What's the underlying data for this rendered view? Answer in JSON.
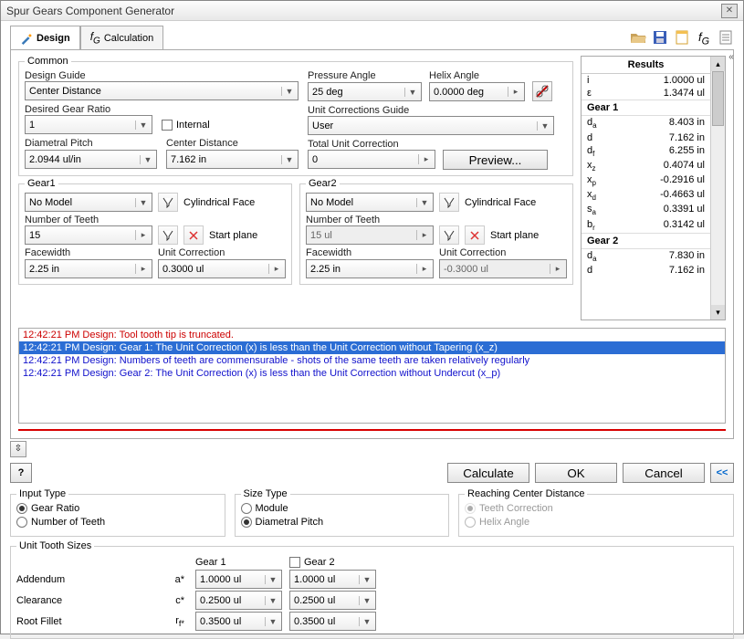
{
  "window": {
    "title": "Spur Gears Component Generator"
  },
  "tabs": {
    "design": "Design",
    "calculation": "Calculation"
  },
  "common": {
    "legend": "Common",
    "designGuideLabel": "Design Guide",
    "designGuideValue": "Center Distance",
    "desiredRatioLabel": "Desired Gear Ratio",
    "desiredRatioValue": "1",
    "internalLabel": "Internal",
    "diametralPitchLabel": "Diametral Pitch",
    "diametralPitchValue": "2.0944 ul/in",
    "centerDistanceLabel": "Center Distance",
    "centerDistanceValue": "7.162 in",
    "pressureAngleLabel": "Pressure Angle",
    "pressureAngleValue": "25 deg",
    "helixAngleLabel": "Helix Angle",
    "helixAngleValue": "0.0000 deg",
    "unitCorrGuideLabel": "Unit Corrections Guide",
    "unitCorrGuideValue": "User",
    "totalUnitCorrLabel": "Total Unit Correction",
    "totalUnitCorrValue": "0",
    "previewLabel": "Preview..."
  },
  "gear1": {
    "legend": "Gear1",
    "modelValue": "No Model",
    "cylFace": "Cylindrical Face",
    "numTeethLabel": "Number of Teeth",
    "numTeethValue": "15",
    "startPlane": "Start plane",
    "facewidthLabel": "Facewidth",
    "facewidthValue": "2.25 in",
    "unitCorrLabel": "Unit Correction",
    "unitCorrValue": "0.3000 ul"
  },
  "gear2": {
    "legend": "Gear2",
    "modelValue": "No Model",
    "cylFace": "Cylindrical Face",
    "numTeethLabel": "Number of Teeth",
    "numTeethValue": "15 ul",
    "startPlane": "Start plane",
    "facewidthLabel": "Facewidth",
    "facewidthValue": "2.25 in",
    "unitCorrLabel": "Unit Correction",
    "unitCorrValue": "-0.3000 ul"
  },
  "results": {
    "title": "Results",
    "rows1": [
      {
        "k": "i",
        "v": "1.0000 ul"
      },
      {
        "k": "ε",
        "v": "1.3474 ul"
      }
    ],
    "g1title": "Gear 1",
    "g1rows": [
      {
        "k": "d<sub>a</sub>",
        "v": "8.403 in"
      },
      {
        "k": "d",
        "v": "7.162 in"
      },
      {
        "k": "d<sub>f</sub>",
        "v": "6.255 in"
      },
      {
        "k": "x<sub>z</sub>",
        "v": "0.4074 ul"
      },
      {
        "k": "x<sub>p</sub>",
        "v": "-0.2916 ul"
      },
      {
        "k": "x<sub>d</sub>",
        "v": "-0.4663 ul"
      },
      {
        "k": "s<sub>a</sub>",
        "v": "0.3391 ul"
      },
      {
        "k": "b<sub>r</sub>",
        "v": "0.3142 ul"
      }
    ],
    "g2title": "Gear 2",
    "g2rows": [
      {
        "k": "d<sub>a</sub>",
        "v": "7.830 in"
      },
      {
        "k": "d",
        "v": "7.162 in"
      }
    ]
  },
  "log": [
    {
      "t": "12:42:21 PM Design: Tool tooth tip is truncated.",
      "cls": "log-red"
    },
    {
      "t": "12:42:21 PM Design: Gear 1: The Unit Correction (x) is less than the Unit Correction without Tapering (x_z)",
      "cls": "log-sel"
    },
    {
      "t": "12:42:21 PM Design: Numbers of teeth are commensurable - shots of the same teeth are taken relatively regularly",
      "cls": "log-blue"
    },
    {
      "t": "12:42:21 PM Design: Gear 2: The Unit Correction (x) is less than the Unit Correction without Undercut (x_p)",
      "cls": "log-blue"
    }
  ],
  "buttons": {
    "calculate": "Calculate",
    "ok": "OK",
    "cancel": "Cancel"
  },
  "inputType": {
    "legend": "Input Type",
    "gearRatio": "Gear Ratio",
    "numTeeth": "Number of Teeth"
  },
  "sizeType": {
    "legend": "Size Type",
    "module": "Module",
    "diametralPitch": "Diametral Pitch"
  },
  "reachCenter": {
    "legend": "Reaching Center Distance",
    "teethCorr": "Teeth Correction",
    "helixAngle": "Helix Angle"
  },
  "tooth": {
    "legend": "Unit Tooth Sizes",
    "g1": "Gear 1",
    "g2": "Gear 2",
    "addendum": "Addendum",
    "addSym": "a*",
    "addV1": "1.0000 ul",
    "addV2": "1.0000 ul",
    "clearance": "Clearance",
    "clrSym": "c*",
    "clrV1": "0.2500 ul",
    "clrV2": "0.2500 ul",
    "rootFillet": "Root Fillet",
    "rfSym": "r",
    "rfSub": "f*",
    "rfV1": "0.3500 ul",
    "rfV2": "0.3500 ul"
  }
}
